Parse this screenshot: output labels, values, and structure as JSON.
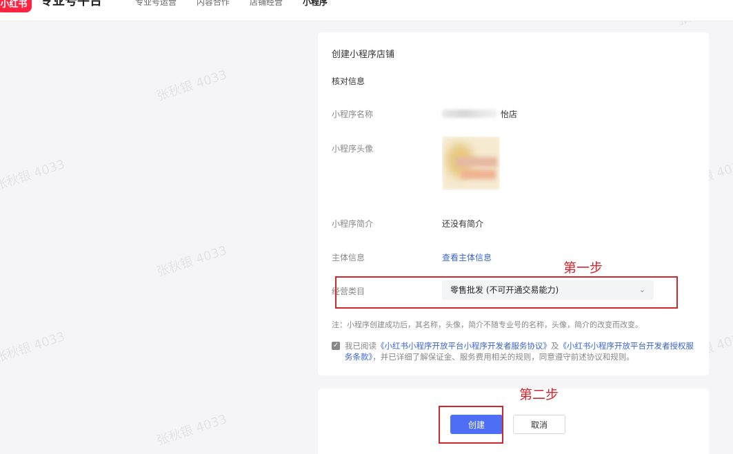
{
  "header": {
    "logo_text": "小红书",
    "brand": "专业号平台",
    "nav": [
      {
        "label": "专业号运营",
        "active": false
      },
      {
        "label": "内容合作",
        "active": false
      },
      {
        "label": "店铺经营",
        "active": false
      },
      {
        "label": "小程序",
        "active": true
      }
    ]
  },
  "form": {
    "title": "创建小程序店铺",
    "section": "核对信息",
    "name_label": "小程序名称",
    "name_suffix": "怡店",
    "avatar_label": "小程序头像",
    "intro_label": "小程序简介",
    "intro_value": "还没有简介",
    "entity_label": "主体信息",
    "entity_link": "查看主体信息",
    "category_label": "经营类目",
    "category_value": "零售批发 (不可开通交易能力)",
    "note": "注：小程序创建成功后，其名称，头像，简介不随专业号的名称，头像，简介的改变而改变。",
    "agree_prefix": "我已阅读",
    "agree_link1": "《小红书小程序开放平台小程序开发者服务协议》",
    "agree_and": "及",
    "agree_link2": "《小红书小程序开放平台开发者授权服务条款》",
    "agree_suffix": "，并已详细了解保证金、服务费用相关的规则，同意遵守前述协议和规则。",
    "agreed": true
  },
  "actions": {
    "create_label": "创建",
    "cancel_label": "取消"
  },
  "annotations": {
    "step1": "第一步",
    "step2": "第二步",
    "color": "#d0262c"
  },
  "watermark": "张秋银 4033",
  "colors": {
    "accent": "#4d6ef5",
    "link": "#3a64d8",
    "brand": "#ff2442"
  }
}
